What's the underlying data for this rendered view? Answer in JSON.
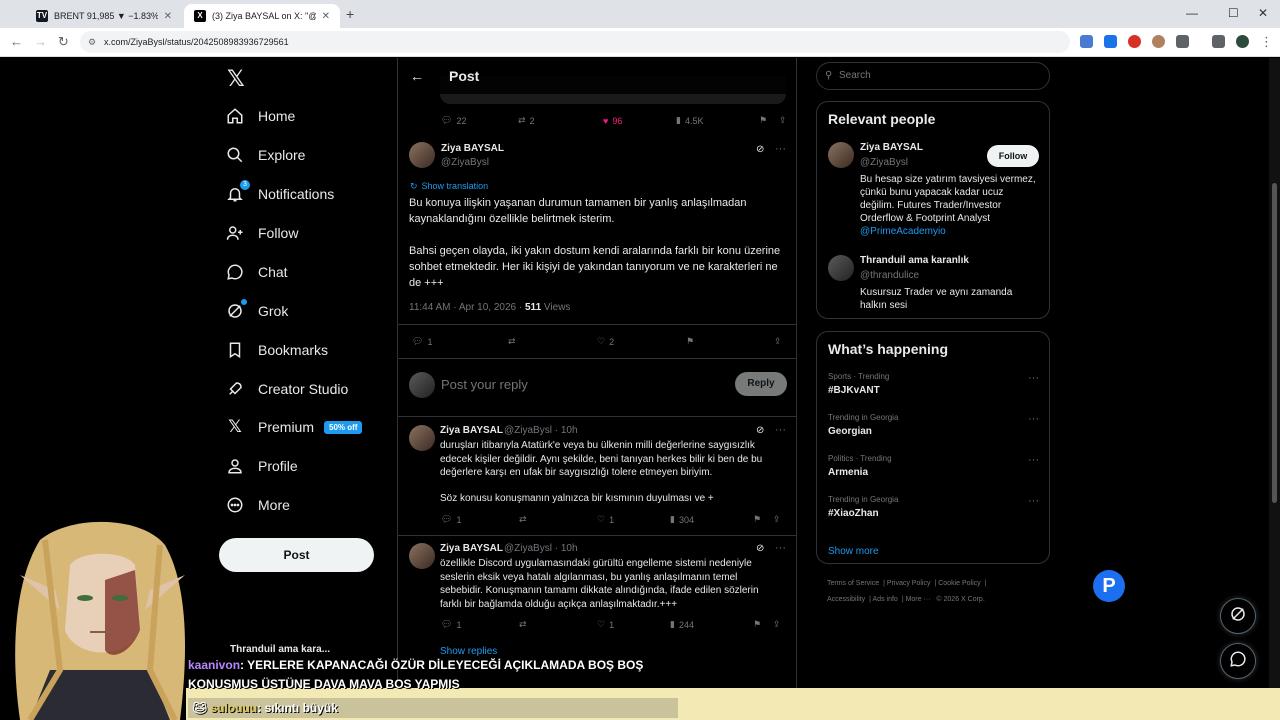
{
  "browser": {
    "tabs": [
      {
        "title": "BRENT 91,985 ▼ −1.83% Adsız",
        "favicon": "TV"
      },
      {
        "title": "(3) Ziya BAYSAL on X: \"@thrand",
        "favicon": "X"
      }
    ],
    "url": "x.com/ZiyaBysl/status/2042508983936729561"
  },
  "nav": {
    "items": [
      {
        "label": "Home",
        "icon": "home-icon"
      },
      {
        "label": "Explore",
        "icon": "search-icon"
      },
      {
        "label": "Notifications",
        "icon": "bell-icon",
        "badge": "3"
      },
      {
        "label": "Follow",
        "icon": "person-plus-icon"
      },
      {
        "label": "Chat",
        "icon": "chat-icon"
      },
      {
        "label": "Grok",
        "icon": "grok-icon"
      },
      {
        "label": "Bookmarks",
        "icon": "bookmark-icon"
      },
      {
        "label": "Creator Studio",
        "icon": "rocket-icon"
      },
      {
        "label": "Premium",
        "icon": "x-icon",
        "badge": "50% off"
      },
      {
        "label": "Profile",
        "icon": "person-icon"
      },
      {
        "label": "More",
        "icon": "more-icon"
      }
    ],
    "post_button": "Post",
    "account_name": "Thranduil ama kara..."
  },
  "header": {
    "title": "Post"
  },
  "prev_stats": {
    "replies": "22",
    "reposts": "2",
    "likes": "96",
    "views": "4.5K"
  },
  "post": {
    "name": "Ziya BAYSAL",
    "handle": "@ZiyaBysl",
    "show_translation": "Show translation",
    "paragraph1": "Bu konuya ilişkin yaşanan durumun tamamen bir yanlış anlaşılmadan kaynaklandığını özellikle belirtmek isterim.",
    "paragraph2": "Bahsi geçen olayda, iki yakın dostum kendi aralarında farklı bir konu üzerine sohbet etmektedir. Her iki kişiyi de yakından tanıyorum ve ne karakterleri ne de +++",
    "time": "11:44 AM · Apr 10, 2026 · ",
    "views": "511",
    "views_label": " Views",
    "replies": "1",
    "likes": "2"
  },
  "reply": {
    "placeholder": "Post your reply",
    "button": "Reply"
  },
  "thread": [
    {
      "name": "Ziya BAYSAL",
      "meta": "@ZiyaBysl · 10h",
      "text": "duruşları itibarıyla Atatürk'e veya bu ülkenin milli değerlerine saygısızlık edecek kişiler değildir. Aynı şekilde, beni tanıyan herkes bilir ki ben de bu değerlere karşı en ufak bir saygısızlığı tolere etmeyen biriyim.",
      "text2": "Söz konusu konuşmanın yalnızca bir kısmının duyulması ve +",
      "replies": "1",
      "likes": "1",
      "views": "304"
    },
    {
      "name": "Ziya BAYSAL",
      "meta": "@ZiyaBysl · 10h",
      "text": "özellikle Discord uygulamasındaki gürültü engelleme sistemi nedeniyle seslerin eksik veya hatalı algılanması, bu yanlış anlaşılmanın temel sebebidir. Konuşmanın tamamı dikkate alındığında, ifade edilen sözlerin farklı bir bağlamda olduğu açıkça anlaşılmaktadır.+++",
      "replies": "1",
      "likes": "1",
      "views": "244"
    }
  ],
  "show_replies": "Show replies",
  "search": {
    "placeholder": "Search"
  },
  "relevant": {
    "title": "Relevant people",
    "people": [
      {
        "name": "Ziya BAYSAL",
        "handle": "@ZiyaBysl",
        "bio": "Bu hesap size yatırım tavsiyesi vermez, çünkü bunu yapacak kadar ucuz değilim. Futures Trader/Investor Orderflow & Footprint Analyst",
        "link": "@PrimeAcademyio",
        "follow": "Follow"
      },
      {
        "name": "Thranduil ama karanlık",
        "handle": "@thrandulice",
        "bio": "Kusursuz Trader ve aynı zamanda halkın sesi"
      }
    ]
  },
  "trends": {
    "title": "What’s happening",
    "items": [
      {
        "category": "Sports · Trending",
        "name": "#BJKvANT"
      },
      {
        "category": "Trending in Georgia",
        "name": "Georgian"
      },
      {
        "category": "Politics · Trending",
        "name": "Armenia"
      },
      {
        "category": "Trending in Georgia",
        "name": "#XiaoZhan"
      }
    ],
    "show_more": "Show more"
  },
  "footer": [
    "Terms of Service",
    "Privacy Policy",
    "Cookie Policy",
    "Accessibility",
    "Ads info",
    "More ···",
    "© 2026 X Corp."
  ],
  "chat": [
    {
      "nick": "kaanivon",
      "text": ": YERLERE KAPANACAĞI ÖZÜR DİLEYECEĞİ AÇIKLAMADA BOŞ BOŞ KONUSMUS ÜSTÜNE DAVA MAVA BOS YAPMIS"
    },
    {
      "nick": "sulouuu",
      "text": ": sıkıntı büyük"
    }
  ],
  "colors": {
    "accent": "#1d9bf0",
    "like": "#f91880",
    "bg": "#000000"
  }
}
